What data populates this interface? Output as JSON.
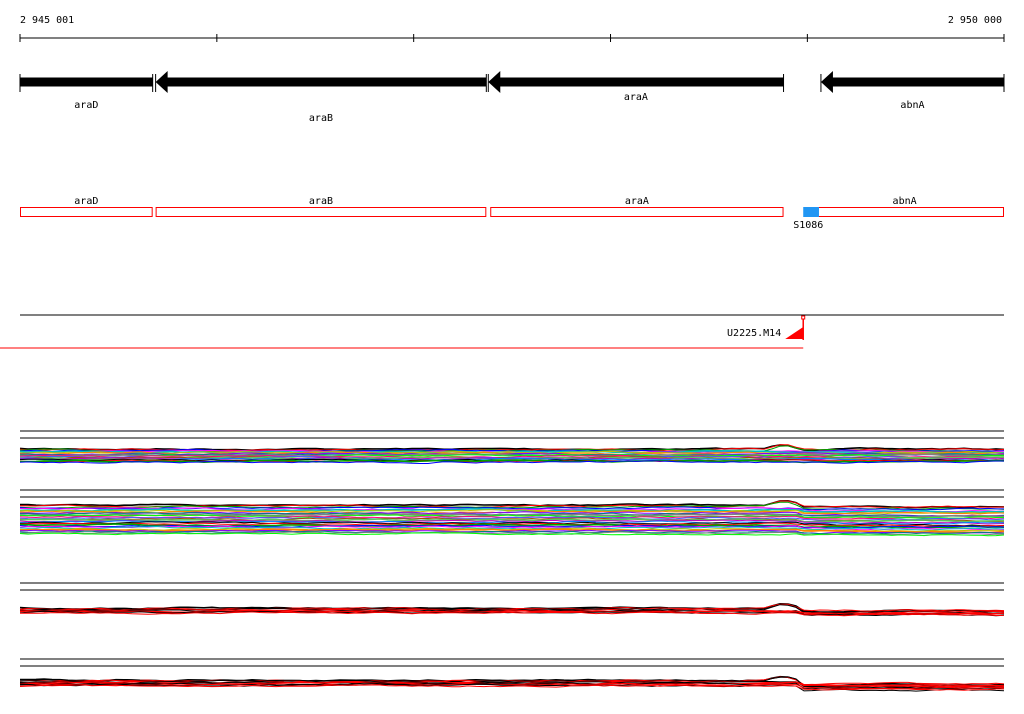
{
  "coordinates": {
    "start": "2 945 001",
    "end": "2 950 000"
  },
  "genes": [
    {
      "name": "araD",
      "from": 2945001,
      "to": 2945675,
      "strand": "-"
    },
    {
      "name": "araB",
      "from": 2945690,
      "to": 2947370,
      "strand": "-"
    },
    {
      "name": "araA",
      "from": 2947380,
      "to": 2948880,
      "strand": "-"
    },
    {
      "name": "abnA",
      "from": 2949070,
      "to": 2950000,
      "strand": "-"
    }
  ],
  "cds_boxes": [
    {
      "name": "araD",
      "from": 2945001,
      "to": 2945675
    },
    {
      "name": "araB",
      "from": 2945690,
      "to": 2947370
    },
    {
      "name": "araA",
      "from": 2947390,
      "to": 2948880
    },
    {
      "name": "abnA",
      "from": 2948990,
      "to": 2950000
    }
  ],
  "features": [
    {
      "name": "S1086",
      "from": 2948980,
      "to": 2949060,
      "color": "#2196f3"
    }
  ],
  "transcripts": [
    {
      "name": "U2225.M14",
      "start": 2948980,
      "color": "#ff0000"
    }
  ],
  "colors": {
    "gene": "#000000",
    "cds_outline": "#ff0000",
    "feature": "#2196f3",
    "transcript": "#ff0000"
  },
  "expression_palette": [
    "#000000",
    "#ff0000",
    "#00a000",
    "#0000ff",
    "#ff00ff",
    "#00c0c0",
    "#c0c000",
    "#ff8000",
    "#8000ff",
    "#008080",
    "#808080",
    "#00ff00",
    "#ff0080",
    "#4060ff",
    "#a05000",
    "#60c060",
    "#c000c0",
    "#0080ff"
  ]
}
